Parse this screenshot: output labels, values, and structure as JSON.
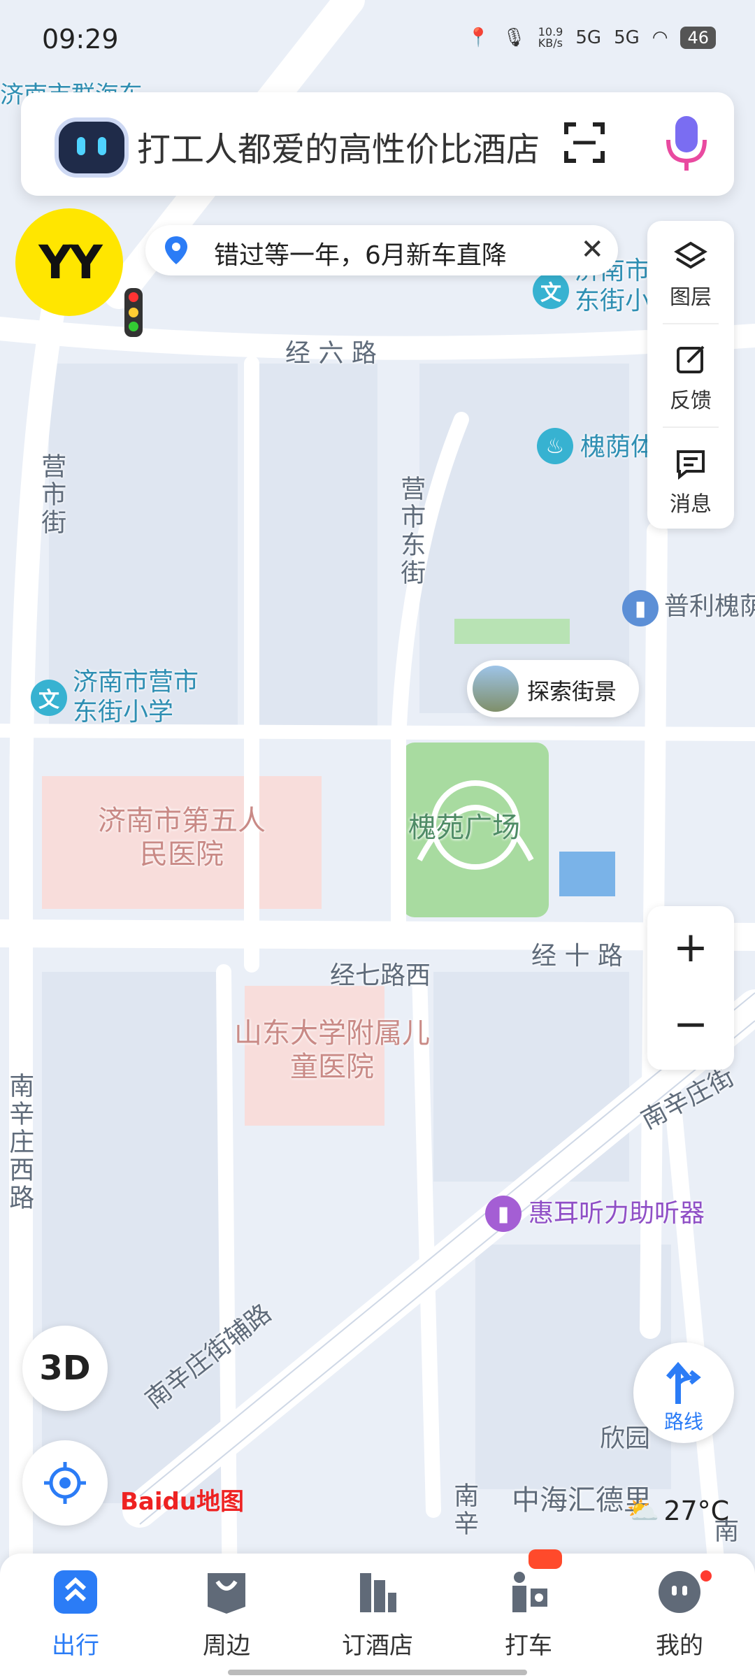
{
  "status_bar": {
    "time": "09:29",
    "net_speed": "10.9\nKB/s",
    "network_1": "5G",
    "network_2": "5G",
    "battery": "46"
  },
  "search": {
    "placeholder": "打工人都爱的高性价比酒店",
    "scan_icon": "scan-icon",
    "mic_icon": "mic-icon"
  },
  "avatar": {
    "label": "YY"
  },
  "notice": {
    "text": "错过等一年，6月新车直降",
    "close_icon": "close-icon"
  },
  "tools": [
    {
      "icon": "layers-icon",
      "label": "图层"
    },
    {
      "icon": "feedback-icon",
      "label": "反馈"
    },
    {
      "icon": "message-icon",
      "label": "消息"
    }
  ],
  "map_labels": {
    "road_jingliu": "经 六 路",
    "road_yingshi": "营市街",
    "road_yingshidong": "营市东街",
    "road_jingshi": "经 十 路",
    "road_jingqixi": "经七路西",
    "road_nanxinzhuangxi": "南辛庄西路",
    "road_nanxinzhuangfu": "南辛庄街辅路",
    "road_nan": "南",
    "road_nanxin": "南辛",
    "road_nan_right": "南",
    "school_1": "济南市营市东街小学",
    "school_top": "济南市东街小",
    "school_top_left": "济南市群海东",
    "hospital_5": "济南市第五人民医院",
    "hospital_child": "山东大学附属儿童医院",
    "park": "槐苑广场",
    "huaiyin": "槐荫体",
    "puli": "普利槐荫",
    "huier": "惠耳听力助听器",
    "xinyuan": "欣园",
    "zhonghai": "中海汇德里",
    "road_nanjie": "南辛庄街"
  },
  "explore": {
    "label": "探索街景"
  },
  "zoom": {
    "plus": "+",
    "minus": "−"
  },
  "buttons": {
    "three_d": "3D",
    "route": "路线",
    "locate_icon": "locate-icon"
  },
  "weather": {
    "temp": "27°C",
    "icon": "cloud-sun-icon"
  },
  "brand": {
    "logo": "Baidu地图"
  },
  "bottom_nav": [
    {
      "icon": "travel-icon",
      "label": "出行",
      "active": true
    },
    {
      "icon": "nearby-icon",
      "label": "周边",
      "active": false
    },
    {
      "icon": "hotel-icon",
      "label": "订酒店",
      "active": false
    },
    {
      "icon": "taxi-icon",
      "label": "打车",
      "active": false
    },
    {
      "icon": "profile-icon",
      "label": "我的",
      "active": false
    }
  ],
  "colors": {
    "accent": "#2b7cf6",
    "park_green": "#a8dba0",
    "hospital_pink": "#f9dcdb",
    "map_bg": "#e9eef6",
    "road": "#ffffff"
  }
}
